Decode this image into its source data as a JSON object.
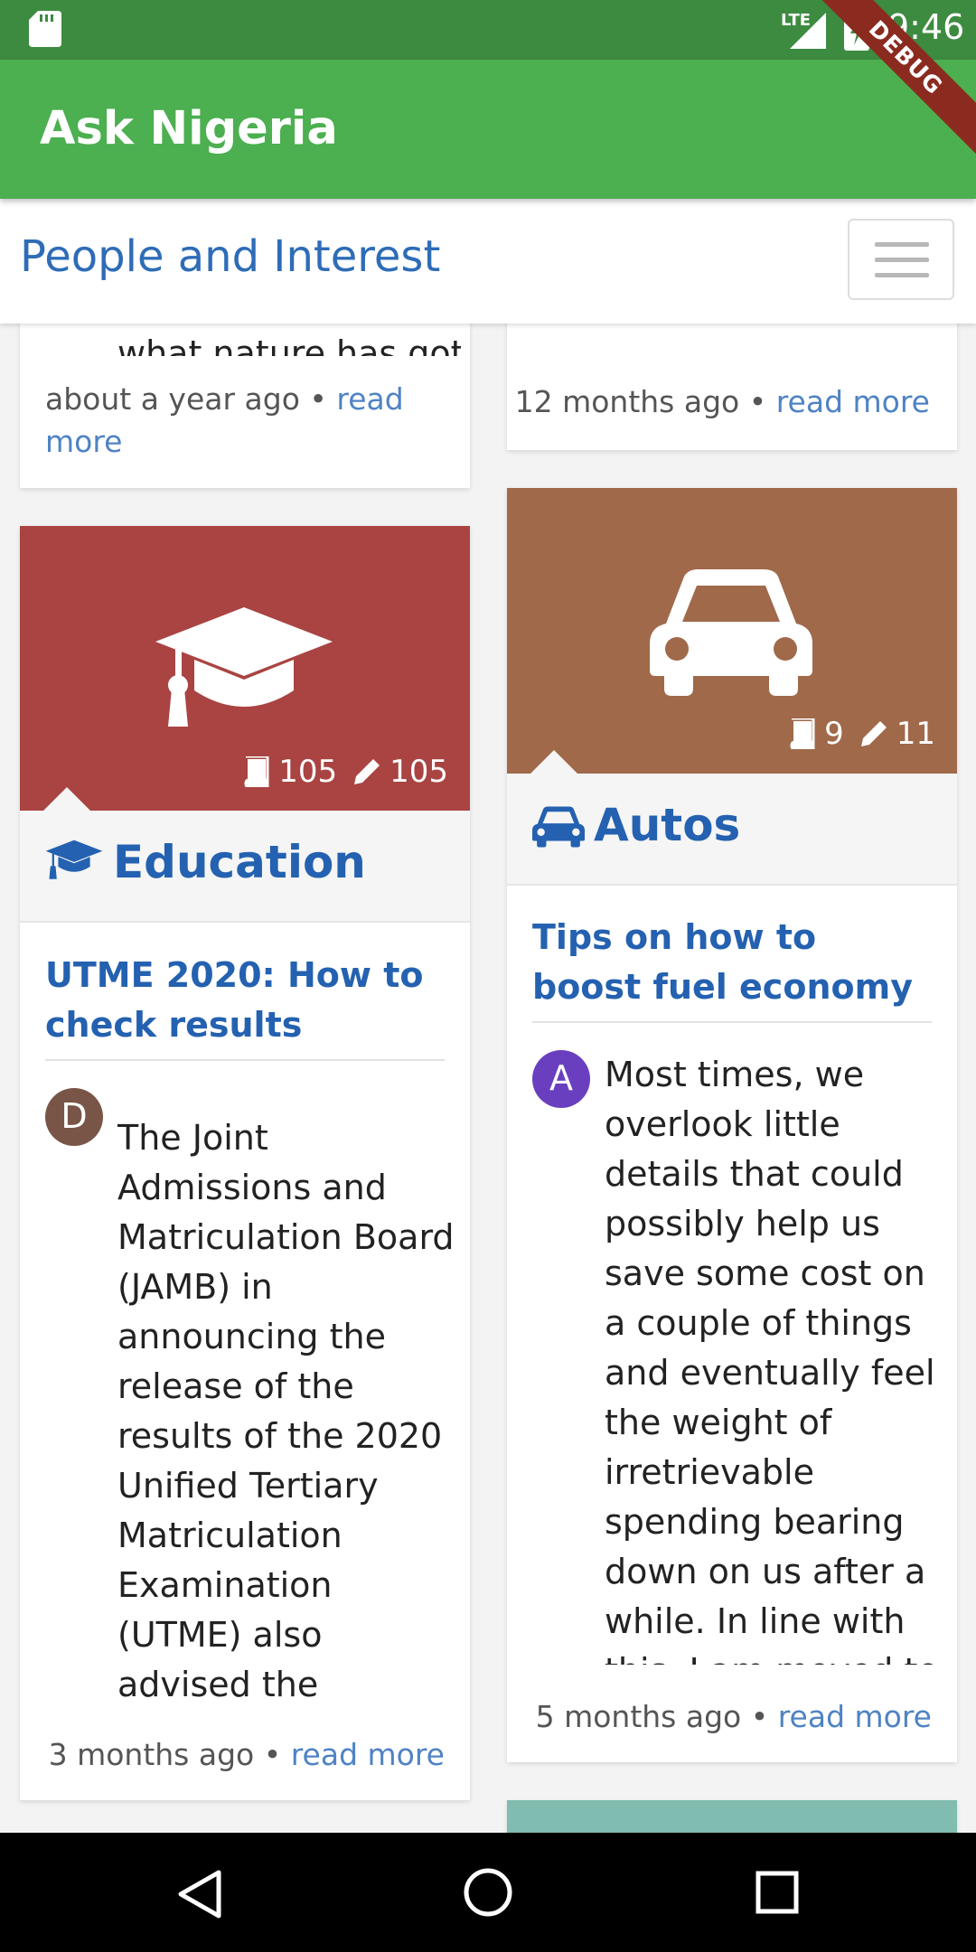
{
  "status_bar": {
    "time": "9:46",
    "network": "LTE",
    "icons": [
      "sd-card-icon",
      "signal-icon",
      "battery-charging-icon"
    ]
  },
  "app_bar": {
    "title": "Ask Nigeria",
    "debug_banner": "DEBUG",
    "color": "#4caf50"
  },
  "nav": {
    "title": "People and Interest",
    "menu_icon": "hamburger-icon"
  },
  "left_top_card": {
    "clipped_text": "what nature has got",
    "time": "about a year ago",
    "separator": "•",
    "read_more": "read more"
  },
  "right_top_card": {
    "time": "12 months ago",
    "separator": "•",
    "read_more": "read more"
  },
  "education": {
    "banner_color": "#a94442",
    "icon": "graduation-cap-icon",
    "questions": "105",
    "answers": "105",
    "label": "Education",
    "post_title": "UTME 2020: How to check results",
    "avatar_letter": "D",
    "avatar_color": "#795548",
    "excerpt": "The Joint Admissions and Matriculation Board (JAMB) in announcing the release of the results of the 2020 Unified Tertiary Matriculation Examination (UTME) also advised the candidates on how",
    "time": "3 months ago",
    "separator": "•",
    "read_more": "read more"
  },
  "autos": {
    "banner_color": "#a0694a",
    "icon": "car-icon",
    "questions": "9",
    "answers": "11",
    "label": "Autos",
    "post_title": "Tips on how to boost fuel economy",
    "avatar_letter": "A",
    "avatar_color": "#6a3fbf",
    "excerpt": "Most times, we overlook little details that could possibly help us save some cost on a couple of things and eventually feel the weight of irretrievable spending bearing down on us after a while. In line with this, I am moved to",
    "time": "5 months ago",
    "separator": "•",
    "read_more": "read more"
  },
  "next_card": {
    "banner_color": "#80bdb0"
  },
  "system_nav": {
    "buttons": [
      "back-icon",
      "home-icon",
      "recents-icon"
    ]
  }
}
